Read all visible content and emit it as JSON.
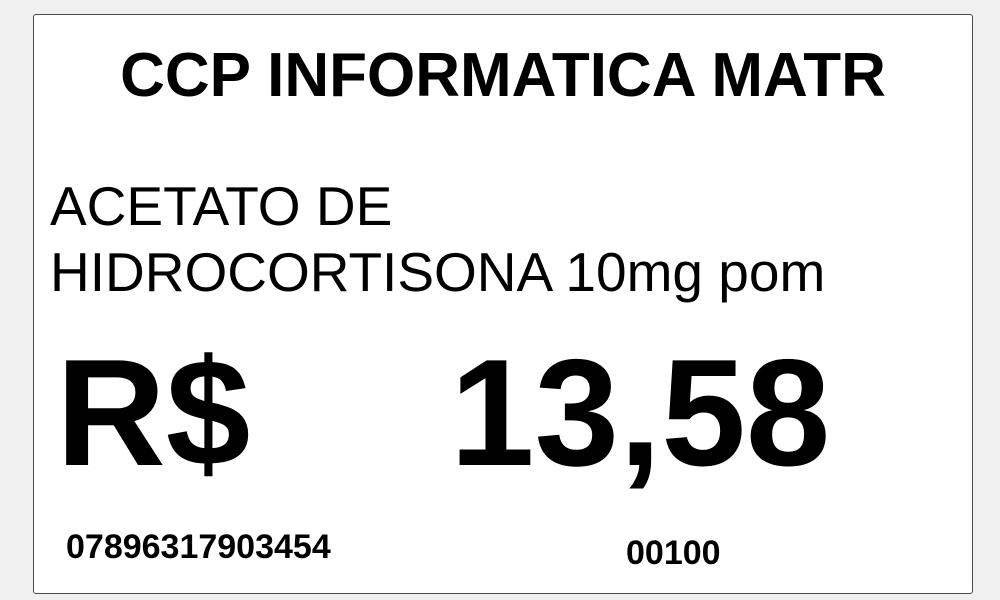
{
  "label": {
    "store_name": "CCP INFORMATICA MATR",
    "product_line1": "ACETATO DE",
    "product_line2": "HIDROCORTISONA 10mg pom",
    "currency": "R$",
    "price": "13,58",
    "barcode": "07896317903454",
    "code": "00100"
  }
}
